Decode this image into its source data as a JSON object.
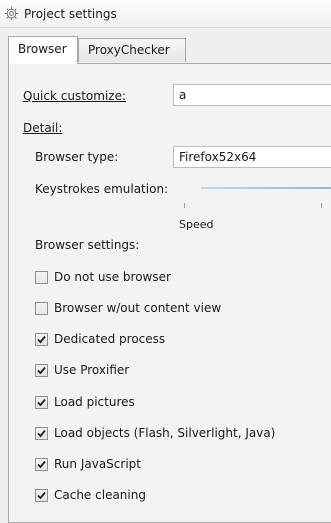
{
  "window": {
    "title": "Project settings",
    "icon": "gear-icon"
  },
  "tabs": [
    {
      "label": "Browser",
      "active": true
    },
    {
      "label": "ProxyChecker",
      "active": false
    }
  ],
  "quick_customize": {
    "label": "Quick customize:",
    "value": "a"
  },
  "detail": {
    "label": "Detail:"
  },
  "browser_type": {
    "label": "Browser type:",
    "value": "Firefox52x64"
  },
  "keystrokes": {
    "label": "Keystrokes emulation:",
    "slider_caption": "Speed"
  },
  "browser_settings": {
    "label": "Browser settings:",
    "items": [
      {
        "label": "Do not use browser",
        "checked": false
      },
      {
        "label": "Browser w/out content view",
        "checked": false
      },
      {
        "label": "Dedicated process",
        "checked": true
      },
      {
        "label": "Use Proxifier",
        "checked": true
      },
      {
        "label": "Load pictures",
        "checked": true
      },
      {
        "label": "Load objects (Flash, Silverlight, Java)",
        "checked": true
      },
      {
        "label": "Run JavaScript",
        "checked": true
      },
      {
        "label": "Cache cleaning",
        "checked": true
      }
    ]
  }
}
